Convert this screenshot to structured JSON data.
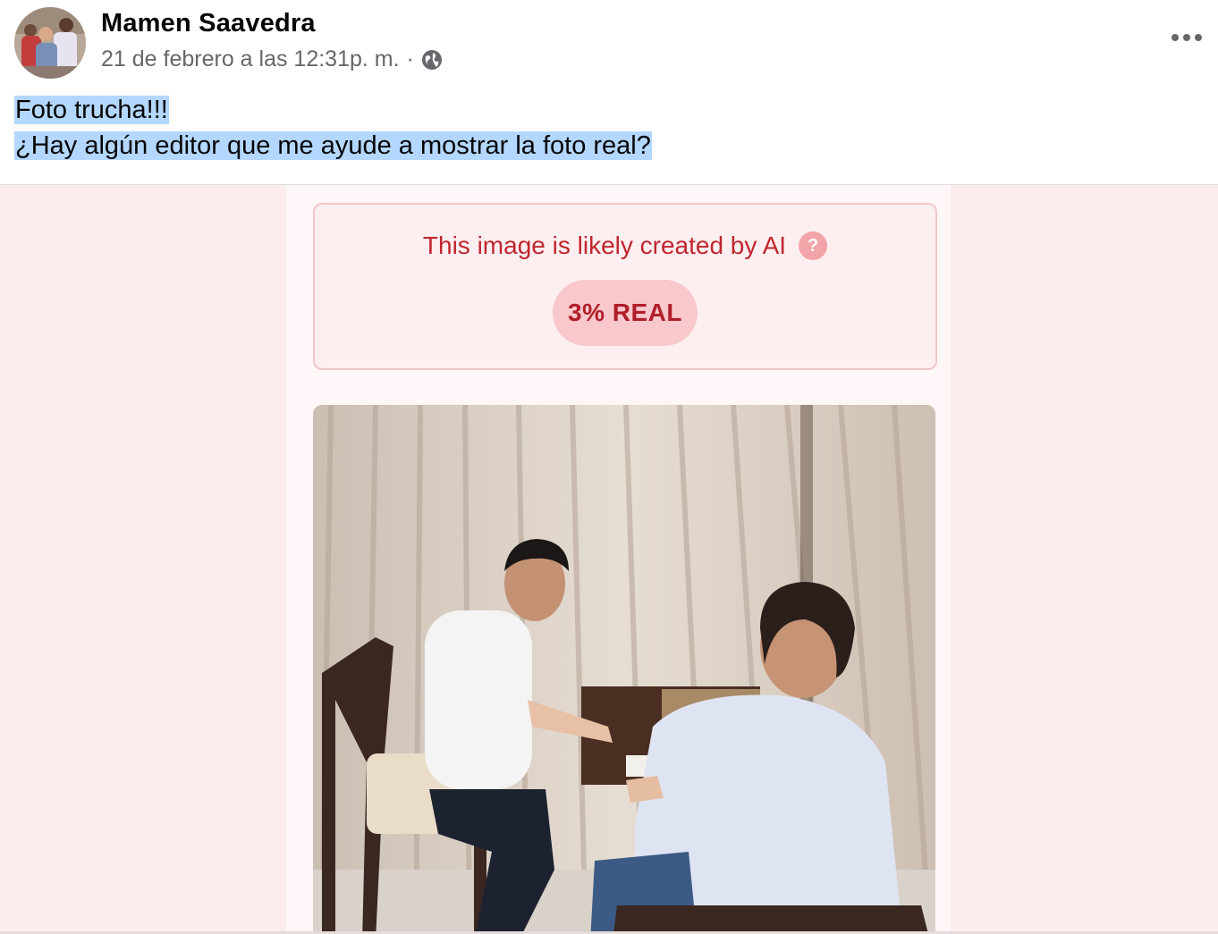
{
  "post": {
    "author": "Mamen Saavedra",
    "timestamp": "21 de febrero a las 12:31p. m.",
    "separator": "·",
    "audience_icon": "globe-icon",
    "more_icon": "more-options-icon",
    "text_line_1": "Foto trucha!!!",
    "text_line_2": "¿Hay algún editor que me ayude a mostrar la foto real?"
  },
  "attachment": {
    "ai_check": {
      "title": "This image is likely created by AI",
      "help_icon": "question-icon",
      "help_glyph": "?",
      "score_label": "3% REAL"
    }
  },
  "colors": {
    "highlight": "#b3d7ff",
    "ai_warning_text": "#c0262f",
    "ai_badge_bg": "#f8c8cc",
    "media_bg": "#fcecec"
  }
}
